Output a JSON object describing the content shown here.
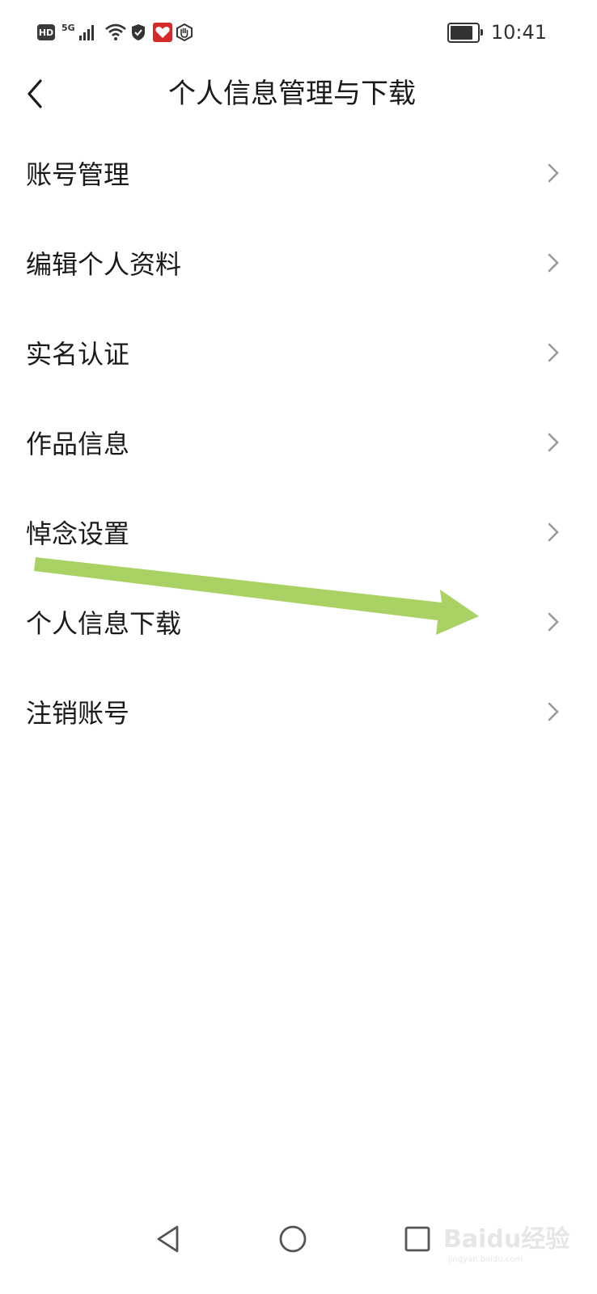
{
  "status_bar": {
    "left_badges": [
      "HD",
      "5G"
    ],
    "icons": [
      "hd-icon",
      "signal-icon",
      "wifi-icon",
      "shield-icon",
      "app-notification-icon",
      "hand-icon"
    ],
    "time": "10:41",
    "battery_level": 0.85
  },
  "header": {
    "back_icon": "chevron-left-icon",
    "title": "个人信息管理与下载"
  },
  "settings": {
    "items": [
      {
        "label": "账号管理"
      },
      {
        "label": "编辑个人资料"
      },
      {
        "label": "实名认证"
      },
      {
        "label": "作品信息"
      },
      {
        "label": "悼念设置"
      },
      {
        "label": "个人信息下载"
      },
      {
        "label": "注销账号"
      }
    ]
  },
  "annotation": {
    "type": "arrow",
    "color": "#a9d163",
    "points_to": "个人信息下载"
  },
  "nav_bar": {
    "buttons": [
      "back-triangle-icon",
      "home-circle-icon",
      "recents-square-icon"
    ]
  },
  "watermark": {
    "text": "Baidu经验",
    "sub": "jingyan.baidu.com"
  },
  "colors": {
    "text": "#1a1a1a",
    "chevron": "#9a9a9a",
    "background": "#ffffff"
  }
}
